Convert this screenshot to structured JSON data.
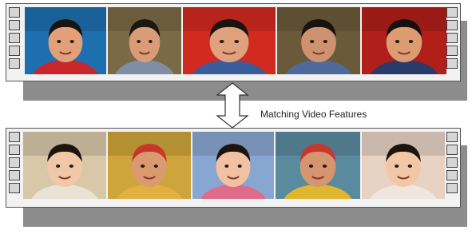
{
  "caption": "Matching Video Features",
  "colors": {
    "film": "#f2f2f2",
    "shadow": "#8c8c8c",
    "hole": "#d6d6d6",
    "border": "#444444"
  },
  "top_strip": {
    "frames": [
      {
        "name": "boy-at-table",
        "bg": "#1e6fb0",
        "skin": "#e2a07a",
        "shirt": "#c8262a",
        "hair": "#1a1410"
      },
      {
        "name": "man-driving",
        "bg": "#7a6a45",
        "skin": "#d89c76",
        "shirt": "#7f8ea5",
        "hair": "#1b1712"
      },
      {
        "name": "boy-eating",
        "bg": "#d12a1f",
        "skin": "#e0a27e",
        "shirt": "#3a5c9a",
        "hair": "#1a1410"
      },
      {
        "name": "man-in-car",
        "bg": "#6b5a3a",
        "skin": "#cf9270",
        "shirt": "#4e6a9a",
        "hair": "#18130f"
      },
      {
        "name": "boy-face-hands",
        "bg": "#b01f1a",
        "skin": "#dd9b72",
        "shirt": "#2a3a6a",
        "hair": "#15110d"
      }
    ]
  },
  "bottom_strip": {
    "frames": [
      {
        "name": "girl-smiling",
        "bg": "#d8c8a8",
        "skin": "#f0c8a8",
        "shirt": "#e9e2d5",
        "hair": "#1d140e"
      },
      {
        "name": "man-cap",
        "bg": "#cfa43a",
        "skin": "#d99a70",
        "shirt": "#e2b040",
        "hair": "#c8372b"
      },
      {
        "name": "girl-pointing",
        "bg": "#88a7d0",
        "skin": "#f1c2a2",
        "shirt": "#e06a8a",
        "hair": "#1d140e"
      },
      {
        "name": "man-store",
        "bg": "#5a8a9e",
        "skin": "#d49570",
        "shirt": "#e0b530",
        "hair": "#c8372b"
      },
      {
        "name": "girl-laughing",
        "bg": "#e8d2c4",
        "skin": "#f2c7a6",
        "shirt": "#efe6df",
        "hair": "#1d140e"
      }
    ]
  }
}
